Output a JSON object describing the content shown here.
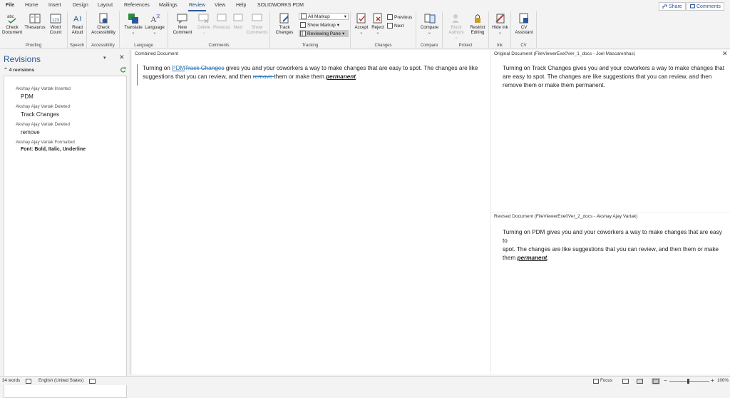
{
  "tabs": [
    "File",
    "Home",
    "Insert",
    "Design",
    "Layout",
    "References",
    "Mailings",
    "Review",
    "View",
    "Help",
    "SOLIDWORKS PDM"
  ],
  "share_label": "Share",
  "comments_label": "Comments",
  "ribbon": {
    "proofing": {
      "label": "Proofing",
      "check_document": "Check Document",
      "thesaurus": "Thesaurus",
      "word_count": "Word Count"
    },
    "speech": {
      "label": "Speech",
      "read_aloud": "Read Aloud"
    },
    "accessibility": {
      "label": "Accessibility",
      "check_accessibility": "Check Accessibility"
    },
    "language": {
      "label": "Language",
      "translate": "Translate",
      "language": "Language"
    },
    "comments": {
      "label": "Comments",
      "new_comment": "New Comment",
      "delete": "Delete",
      "previous": "Previous",
      "next": "Next",
      "show_comments": "Show Comments"
    },
    "tracking": {
      "label": "Tracking",
      "track_changes": "Track Changes",
      "all_markup": "All Markup",
      "show_markup": "Show Markup",
      "reviewing_pane": "Reviewing Pane"
    },
    "changes": {
      "label": "Changes",
      "accept": "Accept",
      "reject": "Reject",
      "previous": "Previous",
      "next": "Next"
    },
    "compare": {
      "label": "Compare",
      "compare": "Compare"
    },
    "protect": {
      "label": "Protect",
      "block_authors": "Block Authors",
      "restrict_editing": "Restrict Editing"
    },
    "ink": {
      "label": "Ink",
      "hide_ink": "Hide Ink"
    },
    "cv": {
      "label": "CV",
      "cv_assistant": "CV Assistant"
    }
  },
  "revisions_pane": {
    "title": "Revisions",
    "count": "4 revisions",
    "items": [
      {
        "author": "Akshay Ajay Vartak Inserted",
        "text": "PDM"
      },
      {
        "author": "Akshay Ajay Vartak Deleted",
        "text": "Track Changes"
      },
      {
        "author": "Akshay Ajay Vartak Deleted",
        "text": "remove"
      },
      {
        "author": "Akshay Ajay Vartak Formatted",
        "text": "Font: Bold, Italic, Underline"
      }
    ]
  },
  "combined": {
    "title": "Combined Document",
    "l1_a": "Turning on ",
    "l1_ins": "PDM",
    "l1_del": "Track Changes",
    "l1_b": " gives you and your coworkers a way to make changes that are easy to spot. The changes are like",
    "l2_a": "suggestions that you can review, and then ",
    "l2_del": "remove ",
    "l2_b": "them or make them ",
    "l2_em": "permanent",
    "l2_c": "."
  },
  "original": {
    "title": "Original Document (FileViewerExe0Ver_1_docs - Joel Mascarenhas)",
    "l1": "Turning on Track Changes gives you and your coworkers a way to make changes that",
    "l2": "are easy to spot. The changes are like suggestions that you can review, and then",
    "l3": "remove them or make them permanent."
  },
  "revised": {
    "title": "Revised Document (FileViewerExe0Ver_2_docs - Akshay Ajay Vartak)",
    "l1": "Turning on PDM gives you and your coworkers a way to make changes that are easy to",
    "l2": "spot. The changes are like suggestions that you can review, and then them or make",
    "l3_a": "them ",
    "l3_em": "permanent",
    "l3_b": "."
  },
  "status": {
    "words": "34 words",
    "language": "English (United States)",
    "focus": "Focus",
    "zoom": "100%"
  },
  "colors": {
    "accent": "#2b579a",
    "markup": "#2e75b6"
  }
}
